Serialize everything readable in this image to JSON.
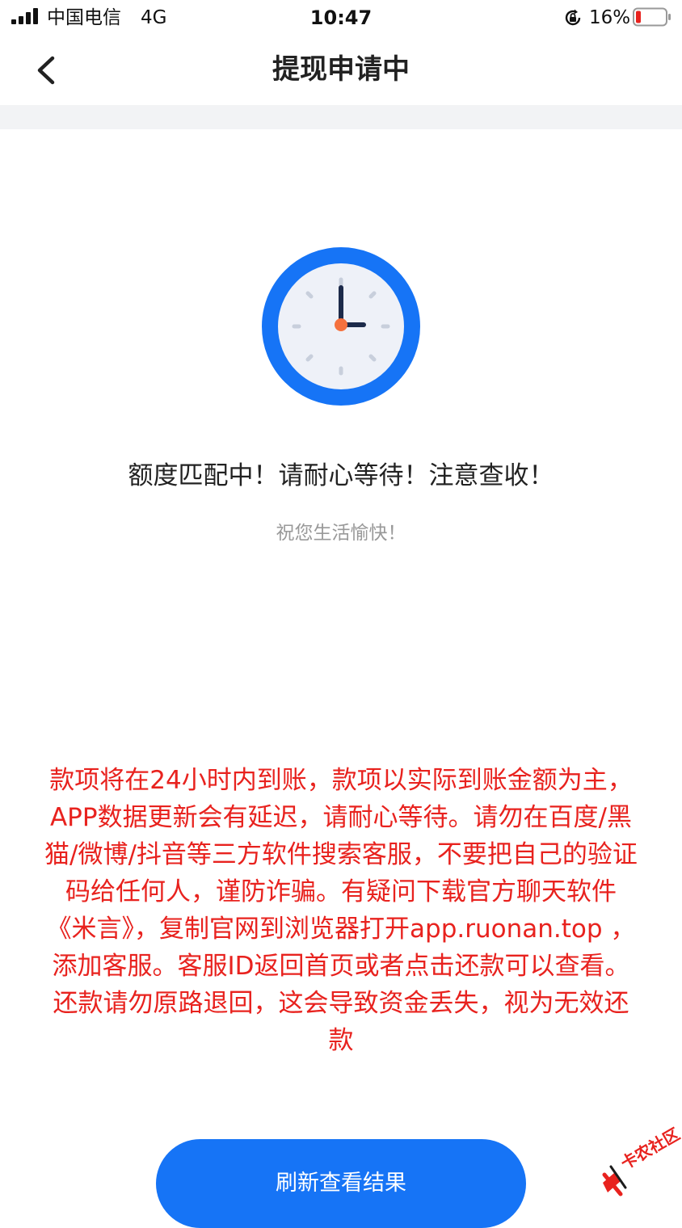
{
  "status_bar": {
    "carrier": "中国电信",
    "network": "4G",
    "time": "10:47",
    "battery_percent": "16%",
    "battery_level": 0.16,
    "battery_color": "#e8221e"
  },
  "nav": {
    "back_icon": "chevron-left-icon",
    "title": "提现申请中"
  },
  "clock": {
    "icon": "clock-icon",
    "ring_color": "#1674f6",
    "face_color": "#eef1f8",
    "hand_color": "#1c2a4a",
    "center_color": "#f5713e"
  },
  "main": {
    "message": "额度匹配中！请耐心等待！注意查收！",
    "sub_message": "祝您生活愉快！",
    "notice": "款项将在24小时内到账，款项以实际到账金额为主，APP数据更新会有延迟，请耐心等待。请勿在百度/黑猫/微博/抖音等三方软件搜索客服，不要把自己的验证码给任何人，谨防诈骗。有疑问下载官方聊天软件《米言》，复制官网到浏览器打开app.ruonan.top ，添加客服。客服ID返回首页或者点击还款可以查看。还款请勿原路退回，这会导致资金丢失，视为无效还款"
  },
  "actions": {
    "refresh_label": "刷新查看结果",
    "button_color": "#1674f6"
  },
  "watermark": {
    "text": "卡农社区"
  }
}
